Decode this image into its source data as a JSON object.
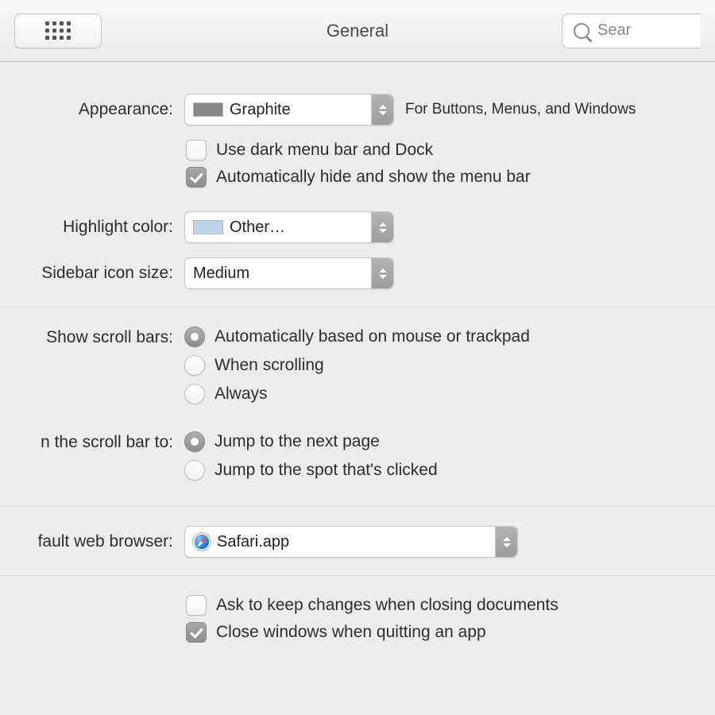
{
  "toolbar": {
    "title": "General",
    "search_placeholder": "Sear"
  },
  "appearance": {
    "label": "Appearance:",
    "value": "Graphite",
    "hint": "For Buttons, Menus, and Windows",
    "dark_menu_label": "Use dark menu bar and Dock",
    "dark_menu_checked": false,
    "auto_hide_label": "Automatically hide and show the menu bar",
    "auto_hide_checked": true
  },
  "highlight": {
    "label": "Highlight color:",
    "value": "Other…"
  },
  "sidebar": {
    "label": "Sidebar icon size:",
    "value": "Medium"
  },
  "scrollbars": {
    "label": "Show scroll bars:",
    "options": [
      {
        "label": "Automatically based on mouse or trackpad",
        "selected": true
      },
      {
        "label": "When scrolling",
        "selected": false
      },
      {
        "label": "Always",
        "selected": false
      }
    ]
  },
  "click_scrollbar": {
    "label": "n the scroll bar to:",
    "options": [
      {
        "label": "Jump to the next page",
        "selected": true
      },
      {
        "label": "Jump to the spot that's clicked",
        "selected": false
      }
    ]
  },
  "browser": {
    "label": "fault web browser:",
    "value": "Safari.app"
  },
  "documents": {
    "ask_keep_label": "Ask to keep changes when closing documents",
    "ask_keep_checked": false,
    "close_windows_label": "Close windows when quitting an app",
    "close_windows_checked": true
  }
}
